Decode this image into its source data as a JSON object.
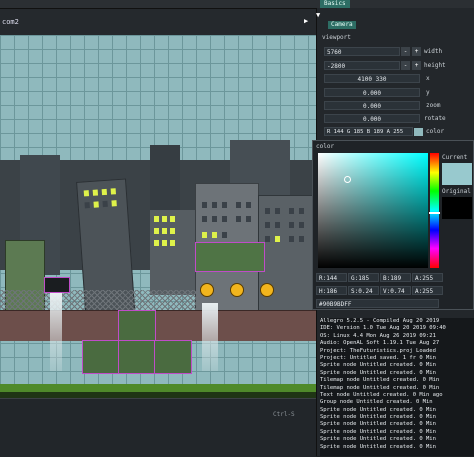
{
  "top_tabs": {
    "left_tab": "",
    "right_tab": "Basics"
  },
  "viewport": {
    "scene_tab": "com2",
    "console_label": "Ctrl-S"
  },
  "panel": {
    "section_button": "Camera",
    "section_title": "viewport",
    "rows": [
      {
        "value": "5760",
        "label": "width"
      },
      {
        "value": "-2800",
        "label": "height"
      },
      {
        "value": "4100 330",
        "label": "x"
      },
      {
        "value": "0.000",
        "label": "y"
      },
      {
        "value": "0.000",
        "label": "zoom"
      },
      {
        "value": "0.000",
        "label": "rotate"
      }
    ],
    "color_row": {
      "value": "R 144 G 185 B 189 A 255",
      "label": "color"
    }
  },
  "picker": {
    "title": "color",
    "current_label": "Current",
    "original_label": "Original",
    "rgb": [
      "R:144",
      "G:185",
      "B:189",
      "A:255"
    ],
    "hsv": [
      "H:186",
      "S:0.24",
      "V:0.74",
      "A:255"
    ],
    "hex": "#90B9BDFF",
    "current_color": "#98c9ce",
    "original_color": "#000000"
  },
  "log": [
    "Allegro 5.2.5 - Compiled Aug 20 2019",
    "IDE: Version 1.0 Tue Aug 20 2019 09:40",
    "OS: Linux 4.4 Mon Aug 26 2019 09:21",
    "Audio: OpenAL Soft 1.19.1 Tue Aug 27",
    "Project: TheFuturistics.proj Loaded",
    "Project: Untitled saved. 1 fr 0 Min",
    "Sprite node Untitled created. 0 Min",
    "Sprite node Untitled created. 0 Min",
    "Tilemap node Untitled created. 0 Min",
    "Tilemap node Untitled created. 0 Min",
    "Text node Untitled created. 0 Min ago",
    "Group node Untitled created. 0 Min",
    "Sprite node Untitled created. 0 Min",
    "Sprite node Untitled created. 0 Min",
    "Sprite node Untitled created. 0 Min",
    "Sprite node Untitled created. 0 Min",
    "Sprite node Untitled created. 0 Min",
    "Sprite node Untitled created. 0 Min"
  ],
  "colors": {
    "accent": "#2d6d64",
    "sky": "#8fb9bd",
    "window_lit": "#dff24a",
    "ground": "#4f8a2a",
    "selection": "#c04cc8"
  }
}
